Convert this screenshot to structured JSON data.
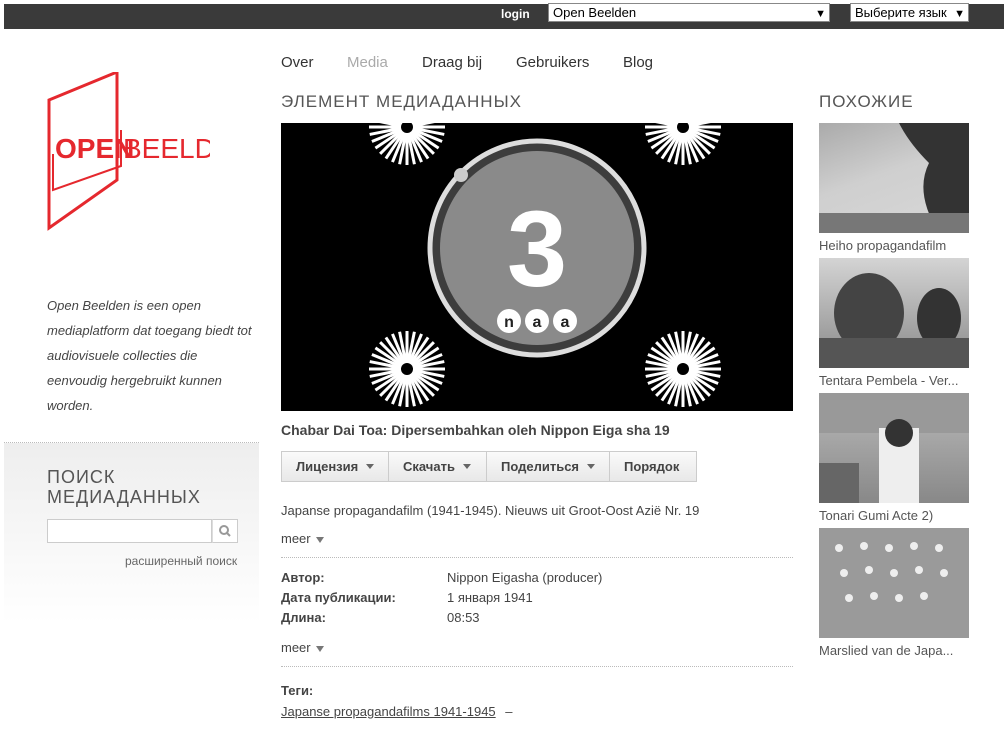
{
  "topbar": {
    "login_label": "login",
    "site_select": "Open Beelden",
    "language_select": "Выберите язык"
  },
  "logo": {
    "text_open": "OPEN",
    "text_beelden": "BEELDEN",
    "brand_color": "#e5282e"
  },
  "about_text": "Open Beelden is een open mediaplatform dat toegang biedt tot audiovisuele collecties die eenvoudig hergebruikt kunnen worden.",
  "search": {
    "title": "ПОИСК МЕДИАДАННЫХ",
    "placeholder": "",
    "advanced_label": "расширенный поиск"
  },
  "nav": [
    "Over",
    "Media",
    "Draag bij",
    "Gebruikers",
    "Blog"
  ],
  "main": {
    "heading": "ЭЛЕМЕНТ МЕДИАДАННЫХ",
    "countdown_number": "3",
    "countdown_letters": [
      "n",
      "a",
      "a"
    ],
    "media_title": "Chabar Dai Toa: Dipersembahkan oleh Nippon Eiga sha 19",
    "buttons": {
      "license": "Лицензия",
      "download": "Скачать",
      "share": "Поделиться",
      "order": "Порядок"
    },
    "description": "Japanse propagandafilm (1941-1945). Nieuws uit Groot-Oost Azië Nr. 19",
    "more_label": "meer",
    "meta": [
      {
        "key": "Автор:",
        "value": "Nippon Eigasha (producer)"
      },
      {
        "key": "Дата публикации:",
        "value": "1 января 1941"
      },
      {
        "key": "Длина:",
        "value": "08:53"
      }
    ],
    "tags_label": "Теги:",
    "tag": "Japanse propagandafilms 1941-1945",
    "tag_sep": "–"
  },
  "similar": {
    "heading": "ПОХОЖИЕ",
    "items": [
      "Heiho propagandafilm",
      "Tentara Pembela - Ver...",
      "Tonari Gumi Acte 2)",
      "Marslied van de Japa..."
    ]
  }
}
